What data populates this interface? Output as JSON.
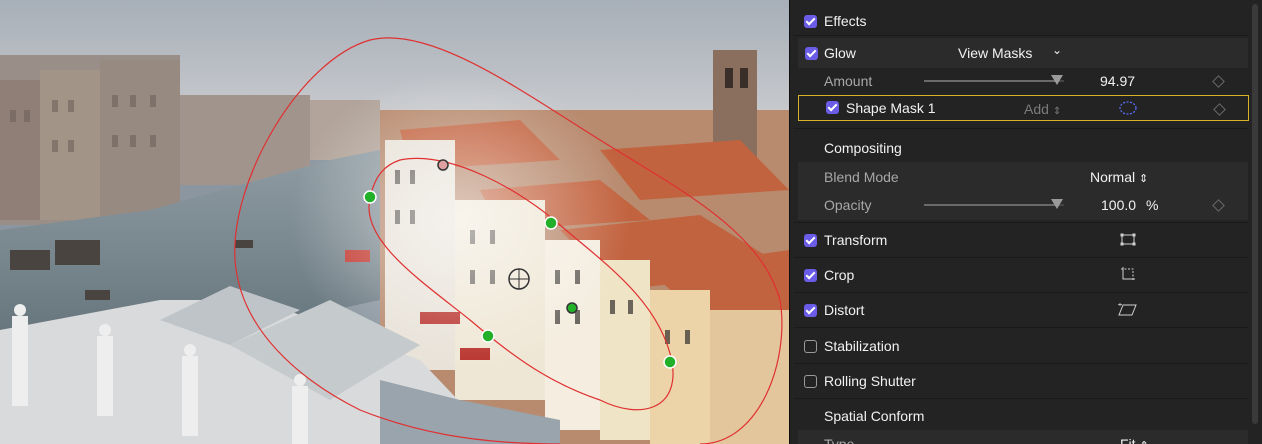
{
  "viewer": {
    "content": "Canal city rooftops photo with shape mask overlay"
  },
  "inspector": {
    "effects_header": "Effects",
    "glow": {
      "label": "Glow",
      "view_masks": "View Masks",
      "amount_label": "Amount",
      "amount_value": "94.97",
      "amount_fraction": 0.95
    },
    "shape_mask": {
      "label": "Shape Mask 1",
      "mode": "Add"
    },
    "compositing": {
      "header": "Compositing",
      "blend_mode_label": "Blend Mode",
      "blend_mode_value": "Normal",
      "opacity_label": "Opacity",
      "opacity_value": "100.0",
      "opacity_unit": "%",
      "opacity_fraction": 1.0
    },
    "sections": [
      {
        "label": "Transform",
        "checked": true,
        "icon": "transform-icon"
      },
      {
        "label": "Crop",
        "checked": true,
        "icon": "crop-icon"
      },
      {
        "label": "Distort",
        "checked": true,
        "icon": "distort-icon"
      },
      {
        "label": "Stabilization",
        "checked": false
      },
      {
        "label": "Rolling Shutter",
        "checked": false
      }
    ],
    "spatial_conform": {
      "header": "Spatial Conform",
      "type_label": "Type",
      "type_value": "Fit"
    }
  },
  "colors": {
    "checkbox": "#6b5ce7",
    "selection_outline": "#d8b22a",
    "mask_curve": "#e03030",
    "control_point": "#22b02a",
    "mask_icon": "#5a6cf0"
  }
}
